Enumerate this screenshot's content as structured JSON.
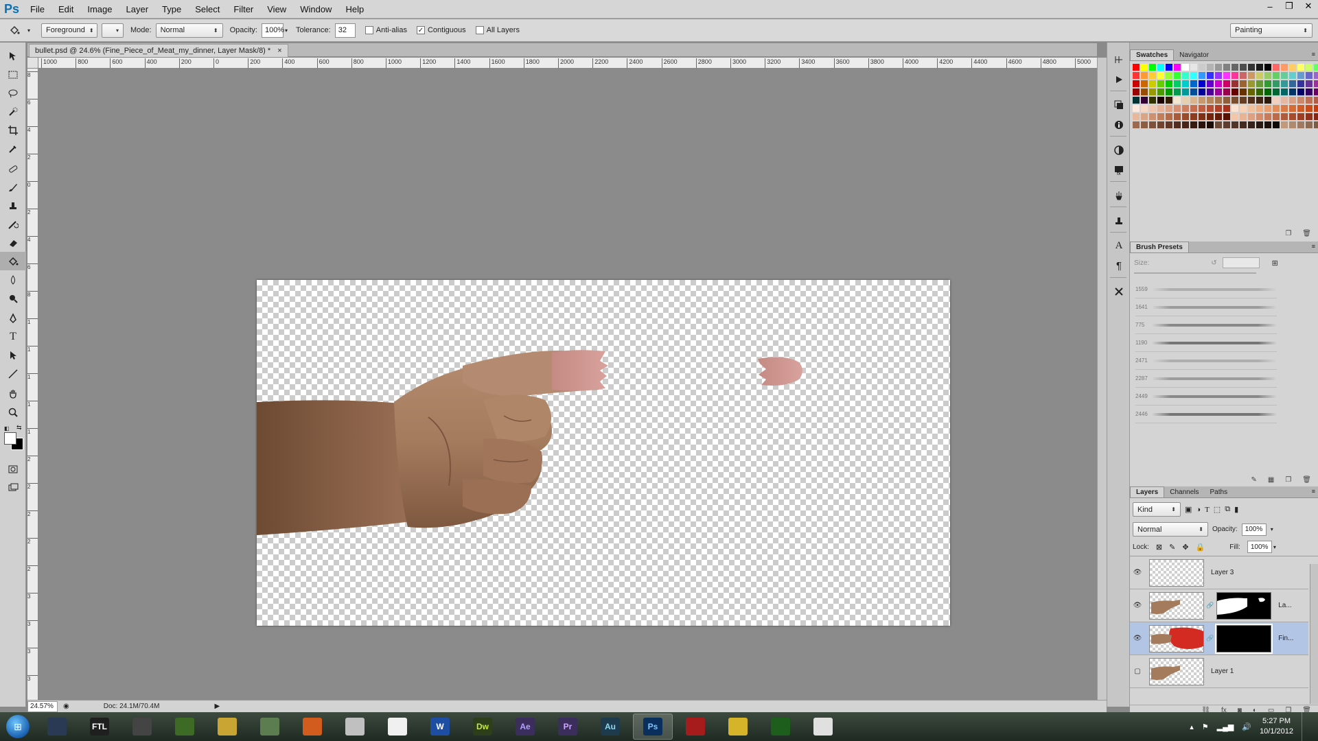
{
  "app": {
    "logo": "Ps"
  },
  "menu": [
    "File",
    "Edit",
    "Image",
    "Layer",
    "Type",
    "Select",
    "Filter",
    "View",
    "Window",
    "Help"
  ],
  "window_controls": {
    "minimize": "–",
    "restore": "❐",
    "close": "✕"
  },
  "options": {
    "fill_source": "Foreground",
    "mode_label": "Mode:",
    "mode_value": "Normal",
    "opacity_label": "Opacity:",
    "opacity_value": "100%",
    "tolerance_label": "Tolerance:",
    "tolerance_value": "32",
    "anti_alias_label": "Anti-alias",
    "anti_alias_checked": false,
    "contiguous_label": "Contiguous",
    "contiguous_checked": true,
    "all_layers_label": "All Layers",
    "all_layers_checked": false,
    "workspace": "Painting"
  },
  "document": {
    "tab_title": "bullet.psd @ 24.6% (Fine_Piece_of_Meat_my_dinner, Layer Mask/8) *",
    "tab_close": "×",
    "zoom": "24.57%",
    "doc_info": "Doc: 24.1M/70.4M"
  },
  "ruler_top": [
    "1000",
    "800",
    "600",
    "400",
    "200",
    "0",
    "200",
    "400",
    "600",
    "800",
    "1000",
    "1200",
    "1400",
    "1600",
    "1800",
    "2000",
    "2200",
    "2400",
    "2600",
    "2800",
    "3000",
    "3200",
    "3400",
    "3600",
    "3800",
    "4000",
    "4200",
    "4400",
    "4600",
    "4800",
    "5000"
  ],
  "ruler_left": [
    "8",
    "6",
    "4",
    "2",
    "0",
    "2",
    "4",
    "6",
    "8",
    "1",
    "1",
    "1",
    "1",
    "1",
    "2",
    "2",
    "2",
    "2",
    "2",
    "3",
    "3",
    "3",
    "3"
  ],
  "panels": {
    "swatches_tab": "Swatches",
    "navigator_tab": "Navigator",
    "brush_presets_tab": "Brush Presets",
    "brush_size_label": "Size:",
    "brushes": [
      "1559",
      "1641",
      "775",
      "1190",
      "2471",
      "2287",
      "2449",
      "2446"
    ],
    "layers_tab": "Layers",
    "channels_tab": "Channels",
    "paths_tab": "Paths",
    "kind_filter": "Kind",
    "blend_mode": "Normal",
    "opacity_label": "Opacity:",
    "opacity_value": "100%",
    "lock_label": "Lock:",
    "fill_label": "Fill:",
    "fill_value": "100%",
    "layers": [
      {
        "name": "Layer 3",
        "visible": true,
        "selected": false
      },
      {
        "name": "La...",
        "visible": true,
        "selected": false
      },
      {
        "name": "Fin...",
        "visible": true,
        "selected": true
      },
      {
        "name": "Layer 1",
        "visible": false,
        "selected": false
      }
    ]
  },
  "swatch_colors": [
    "#ff0000",
    "#ffff00",
    "#00ff00",
    "#00ffff",
    "#0000ff",
    "#ff00ff",
    "#ffffff",
    "#e6e6e6",
    "#cccccc",
    "#b3b3b3",
    "#999999",
    "#808080",
    "#666666",
    "#4d4d4d",
    "#333333",
    "#1a1a1a",
    "#000000",
    "#ff6666",
    "#ff9966",
    "#ffcc66",
    "#ffff66",
    "#ccff66",
    "#66ff66",
    "#66ffcc",
    "#ff3333",
    "#ff9933",
    "#ffcc33",
    "#ffff33",
    "#99ff33",
    "#33ff33",
    "#33ffcc",
    "#33ffff",
    "#3399ff",
    "#3333ff",
    "#9933ff",
    "#ff33ff",
    "#ff3399",
    "#cc6666",
    "#cc9966",
    "#cccc66",
    "#99cc66",
    "#66cc66",
    "#66cc99",
    "#66cccc",
    "#6699cc",
    "#6666cc",
    "#9966cc",
    "#cc66cc",
    "#cc0000",
    "#cc6600",
    "#cccc00",
    "#66cc00",
    "#00cc00",
    "#00cc66",
    "#00cccc",
    "#0066cc",
    "#0000cc",
    "#6600cc",
    "#cc00cc",
    "#cc0066",
    "#993333",
    "#996633",
    "#999933",
    "#669933",
    "#339933",
    "#339966",
    "#339999",
    "#336699",
    "#333399",
    "#663399",
    "#993399",
    "#993366",
    "#990000",
    "#994d00",
    "#999900",
    "#4d9900",
    "#009900",
    "#00994d",
    "#009999",
    "#004d99",
    "#000099",
    "#4d0099",
    "#990099",
    "#99004d",
    "#660000",
    "#663300",
    "#666600",
    "#336600",
    "#006600",
    "#006633",
    "#006666",
    "#003366",
    "#000066",
    "#330066",
    "#660066",
    "#660033",
    "#003333",
    "#330033",
    "#333300",
    "#1a0000",
    "#331a00",
    "#f5e6d0",
    "#e8cfb0",
    "#d9b48f",
    "#c8996f",
    "#b8865c",
    "#a6734a",
    "#8f5e3a",
    "#7a4d2e",
    "#653d23",
    "#52301b",
    "#3f2413",
    "#2d190c",
    "#f2d0c0",
    "#e6b8a2",
    "#d9a085",
    "#cc886b",
    "#bf7055",
    "#b35c44",
    "#a64a36",
    "#ffe9dc",
    "#f7d7c4",
    "#efc5ad",
    "#e7b398",
    "#dfa184",
    "#d78f71",
    "#cf7e5f",
    "#c76d4f",
    "#bf5d40",
    "#b74e33",
    "#af4027",
    "#a7331c",
    "#fde3cf",
    "#f9d2b5",
    "#f3c09c",
    "#edae84",
    "#e79d6e",
    "#e18c59",
    "#db7b46",
    "#d56b35",
    "#cf5b26",
    "#c94c19",
    "#c33e0f",
    "#bd3106",
    "#e8b89a",
    "#dba484",
    "#ce916f",
    "#c17e5b",
    "#b46c49",
    "#a75b39",
    "#9a4b2b",
    "#8d3c1f",
    "#803015",
    "#73240d",
    "#661a07",
    "#591103",
    "#f4c7a8",
    "#e9b393",
    "#dea07f",
    "#d38d6c",
    "#c87b5a",
    "#bd6a4a",
    "#b25a3c",
    "#a74b2f",
    "#9c3d24",
    "#91311a",
    "#862612",
    "#7b1c0b",
    "#9b6a4f",
    "#8d5d44",
    "#7f503a",
    "#714430",
    "#633827",
    "#552d1f",
    "#472318",
    "#391a11",
    "#2b120b",
    "#1d0b06",
    "#6b4a38",
    "#5e3f2f",
    "#513527",
    "#442b1f",
    "#372118",
    "#2a1812",
    "#1d100b",
    "#100805",
    "#c19a7e",
    "#b08a6f",
    "#9f7a60",
    "#8e6b52",
    "#7d5c44",
    "#6c4e37"
  ],
  "taskbar": {
    "apps": [
      "",
      "FTL",
      "",
      "",
      "",
      "",
      "",
      "",
      "",
      "W",
      "Dw",
      "Ae",
      "Pr",
      "Au",
      "Ps",
      "",
      "",
      "",
      ""
    ],
    "time": "5:27 PM",
    "date": "10/1/2012"
  },
  "colors": {
    "accent_selection": "#b3c5e4",
    "ps_blue": "#0a6fb3"
  }
}
